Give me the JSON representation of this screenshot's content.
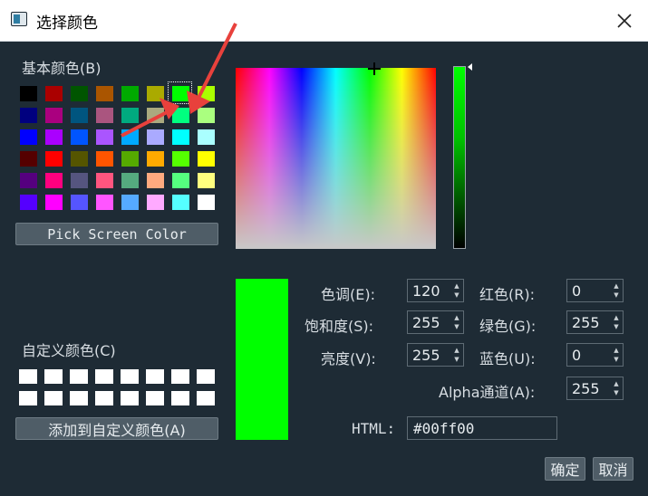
{
  "window": {
    "title": "选择颜色",
    "close_glyph": "✕",
    "icon": "app-window-icon"
  },
  "basic_colors": {
    "label": "基本颜色(B)",
    "rows": [
      [
        "#000000",
        "#aa0000",
        "#005500",
        "#aa5500",
        "#00aa00",
        "#aaaa00",
        "#00ff00",
        "#aaff00"
      ],
      [
        "#00007f",
        "#aa007f",
        "#00557f",
        "#aa557f",
        "#00aa7f",
        "#aaaa7f",
        "#00ff7f",
        "#aaff7f"
      ],
      [
        "#0000ff",
        "#aa00ff",
        "#0055ff",
        "#aa55ff",
        "#00aaff",
        "#aaaaff",
        "#00ffff",
        "#aaffff"
      ],
      [
        "#550000",
        "#ff0000",
        "#555500",
        "#ff5500",
        "#55aa00",
        "#ffaa00",
        "#55ff00",
        "#ffff00"
      ],
      [
        "#55007f",
        "#ff007f",
        "#55557f",
        "#ff557f",
        "#55aa7f",
        "#ffaa7f",
        "#55ff7f",
        "#ffff7f"
      ],
      [
        "#5500ff",
        "#ff00ff",
        "#5555ff",
        "#ff55ff",
        "#55aaff",
        "#ffaaff",
        "#55ffff",
        "#ffffff"
      ]
    ],
    "selected": {
      "row": 0,
      "col": 6
    }
  },
  "pick_screen_color_label": "Pick Screen Color",
  "custom_colors": {
    "label": "自定义颜色(C)",
    "slot_color": "#ffffff",
    "rows": 2,
    "cols": 8
  },
  "add_custom_label": "添加到自定义颜色(A)",
  "current_color": "#00ff00",
  "fields": {
    "hue": {
      "label": "色调(E):",
      "value": "120"
    },
    "saturation": {
      "label": "饱和度(S):",
      "value": "255"
    },
    "value": {
      "label": "亮度(V):",
      "value": "255"
    },
    "red": {
      "label": "红色(R):",
      "value": "0"
    },
    "green": {
      "label": "绿色(G):",
      "value": "255"
    },
    "blue": {
      "label": "蓝色(U):",
      "value": "0"
    },
    "alpha": {
      "label": "Alpha通道(A):",
      "value": "255"
    },
    "html": {
      "label": "HTML:",
      "value": "#00ff00"
    }
  },
  "buttons": {
    "ok": "确定",
    "cancel": "取消"
  },
  "spin_up_glyph": "▲",
  "spin_down_glyph": "▼",
  "annotation_color": "#e8413c"
}
